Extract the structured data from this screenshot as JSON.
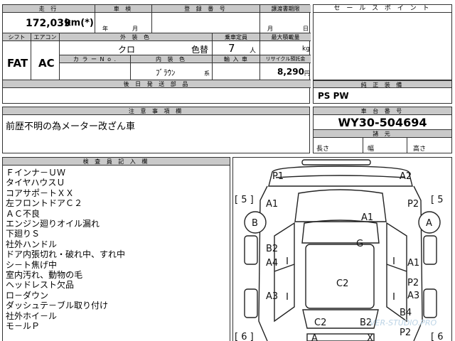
{
  "top_form": {
    "mileage_label": "走 行",
    "mileage_value": "172,039",
    "mileage_unit": "km(*)",
    "inspection_label": "車 検",
    "inspection_year": "年",
    "inspection_month": "月",
    "registration_label": "登 録 番 号",
    "transfer_deadline_label": "譲渡書期限",
    "transfer_month": "月",
    "transfer_day": "日",
    "shift_label": "シフト",
    "shift_value": "FAT",
    "aircon_label": "エアコン",
    "aircon_value": "AC",
    "exterior_color_label": "外 装 色",
    "exterior_color_value": "クロ",
    "color_change": "色替",
    "capacity_label": "乗車定員",
    "capacity_value": "7",
    "capacity_unit": "人",
    "max_load_label": "最大積載量",
    "max_load_unit": "kg",
    "color_no_label": "カ ラ ー N o .",
    "interior_color_label": "内 装 色",
    "interior_color_value": "ﾌﾞﾗｳﾝ",
    "interior_color_unit": "系",
    "import_label": "輸 入 車",
    "recycle_label": "リサイクル預託金",
    "recycle_value": "8,290",
    "recycle_unit": "円",
    "later_parts_label": "後 日 発 送 部 品"
  },
  "sales_point": {
    "label": "セ ー ル ス ポ イ ン ト"
  },
  "equipment": {
    "label": "純 正 装 備",
    "value": "PS PW"
  },
  "notes": {
    "label": "注 意 事 項 欄",
    "value": "前歴不明の為メーター改ざん車"
  },
  "chassis": {
    "label": "車 台 番 号",
    "value": "WY30-504694",
    "dims_label": "諸 元",
    "length": "長さ",
    "width": "幅",
    "height": "高さ"
  },
  "inspector": {
    "label": "検 査 員 記 入 欄",
    "lines": [
      "Ｆインナ－ＵＷ",
      "タイヤハウスＵ",
      "コアサポ－トＸＸ",
      "左フロントドアＣ２",
      "ＡＣ不良",
      "エンジン廻りオイル漏れ",
      "下廻りＳ",
      "社外ハンドル",
      "ドア内張切れ・破れ中、すれ中",
      "シ－ト焦げ中",
      "室内汚れ、動物の毛",
      "ヘッドレスト欠品",
      "ロ－ダウン",
      "ダッシュテ－ブル取り付け",
      "社外ホイ－ル",
      "モ－ルＰ"
    ]
  },
  "diagram": {
    "marks": [
      {
        "text": "P1"
      },
      {
        "text": "A2"
      },
      {
        "text": "A1"
      },
      {
        "text": "P2"
      },
      {
        "text": "A1"
      },
      {
        "text": "G"
      },
      {
        "text": "B2"
      },
      {
        "text": "A1"
      },
      {
        "text": "A4"
      },
      {
        "text": "C2"
      },
      {
        "text": "P2"
      },
      {
        "text": "A3"
      },
      {
        "text": "A3"
      },
      {
        "text": "B4"
      },
      {
        "text": "C2"
      },
      {
        "text": "B2"
      },
      {
        "text": "P2"
      },
      {
        "text": "A"
      },
      {
        "text": "X"
      }
    ],
    "wheel_left": "B",
    "wheel_right": "A",
    "bracket_top_left": "[ 5 ]",
    "bracket_top_right": "[ 5",
    "bracket_bottom_left": "[ 6 ]",
    "bracket_bottom_right": "[ 6",
    "watermark": "VER-STUDIO.PRO"
  }
}
